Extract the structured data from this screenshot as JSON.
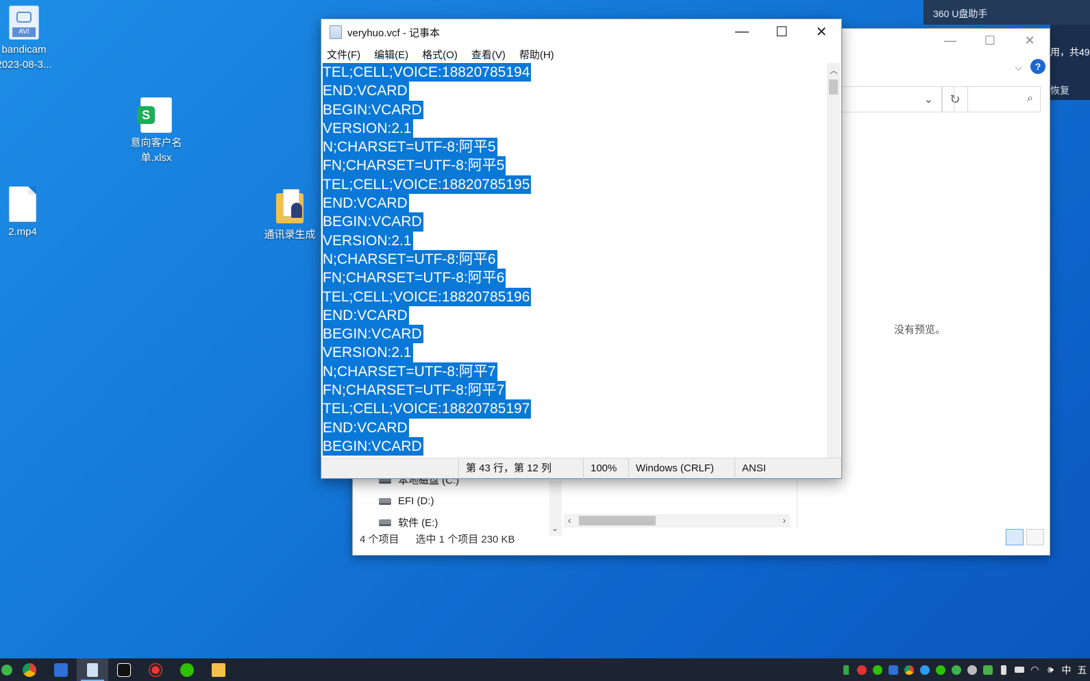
{
  "desktop": {
    "icons": [
      {
        "label1": "bandicam",
        "label2": "2023-08-3...",
        "type_tag": "AVI"
      },
      {
        "label1": "意向客户名",
        "label2": "单.xlsx",
        "type_tag": "S"
      },
      {
        "label1": "2.mp4"
      },
      {
        "label1": "通讯录生成"
      }
    ]
  },
  "panel360": {
    "title": "360 U盘助手",
    "text1": "用，共49",
    "text2": "恢复"
  },
  "explorer": {
    "preview_text": "没有预览。",
    "nav": [
      {
        "label": "本地磁盘 (C:)"
      },
      {
        "label": "EFI (D:)"
      },
      {
        "label": "软件 (E:)"
      }
    ],
    "status": {
      "items": "4 个项目",
      "selected": "选中 1 个项目  230 KB"
    }
  },
  "notepad": {
    "title": "veryhuo.vcf - 记事本",
    "menu": [
      "文件(F)",
      "编辑(E)",
      "格式(O)",
      "查看(V)",
      "帮助(H)"
    ],
    "lines": [
      "TEL;CELL;VOICE:18820785194",
      "END:VCARD",
      "BEGIN:VCARD",
      "VERSION:2.1",
      "N;CHARSET=UTF-8:阿平5",
      "FN;CHARSET=UTF-8:阿平5",
      "TEL;CELL;VOICE:18820785195",
      "END:VCARD",
      "BEGIN:VCARD",
      "VERSION:2.1",
      "N;CHARSET=UTF-8:阿平6",
      "FN;CHARSET=UTF-8:阿平6",
      "TEL;CELL;VOICE:18820785196",
      "END:VCARD",
      "BEGIN:VCARD",
      "VERSION:2.1",
      "N;CHARSET=UTF-8:阿平7",
      "FN;CHARSET=UTF-8:阿平7",
      "TEL;CELL;VOICE:18820785197",
      "END:VCARD",
      "BEGIN:VCARD"
    ],
    "status": {
      "position": "第 43 行，第 12 列",
      "zoom": "100%",
      "line_ending": "Windows (CRLF)",
      "encoding": "ANSI"
    },
    "selection_color": "#0a78d7"
  },
  "taskbar": {
    "tray_ime": "中",
    "tray_last": "五"
  }
}
